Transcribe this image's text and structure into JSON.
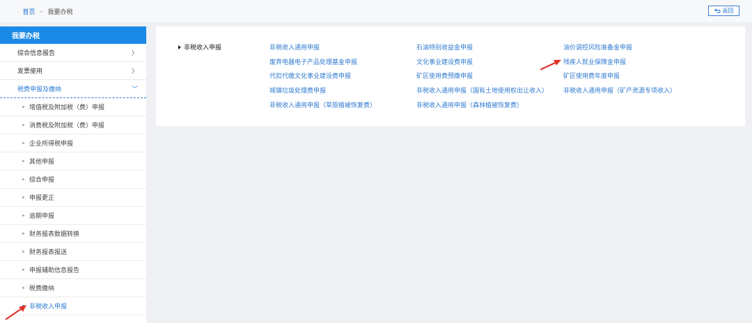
{
  "breadcrumb": {
    "home": "首页",
    "current": "我要办税"
  },
  "back_button": {
    "label": "返回"
  },
  "sidebar": {
    "title": "我要办税",
    "top_items": [
      {
        "label": "综合信息报告",
        "chevron": "〉"
      },
      {
        "label": "发票使用",
        "chevron": "〉"
      },
      {
        "label": "税费申报及缴纳",
        "chevron": "﹀"
      }
    ],
    "sub_items": [
      "增值税及附加税（费）申报",
      "消费税及附加税（费）申报",
      "企业所得税申报",
      "其他申报",
      "综合申报",
      "申报更正",
      "逾期申报",
      "财务报表数据转换",
      "财务报表报送",
      "申报辅助信息报告",
      "税费缴纳",
      "非税收入申报"
    ],
    "active_index": 11
  },
  "panel": {
    "category": "非税收入申报",
    "links": {
      "col1": [
        "非税收入通用申报",
        "废弃电器电子产品处理基金申报",
        "代扣代缴文化事业建设费申报",
        "城镇垃圾处理费申报",
        "非税收入通用申报（草原植被恢复费）"
      ],
      "col2": [
        "石油特别收益金申报",
        "文化事业建设费申报",
        "矿区使用费预缴申报",
        "非税收入通用申报（国有土地使用权出让收入）",
        "非税收入通用申报（森林植被恢复费）"
      ],
      "col3": [
        "油价调控风险准备金申报",
        "残疾人就业保障金申报",
        "矿区使用费年度申报",
        "非税收入通用申报（矿产资源专项收入）"
      ]
    }
  },
  "colors": {
    "accent": "#1a8ae6",
    "link": "#2f7ad0",
    "annotation_arrow": "#e0322b"
  },
  "icons": {
    "back": "return-arrow-icon",
    "bullet": "dot-icon",
    "annotation": "red-arrow-icon"
  }
}
